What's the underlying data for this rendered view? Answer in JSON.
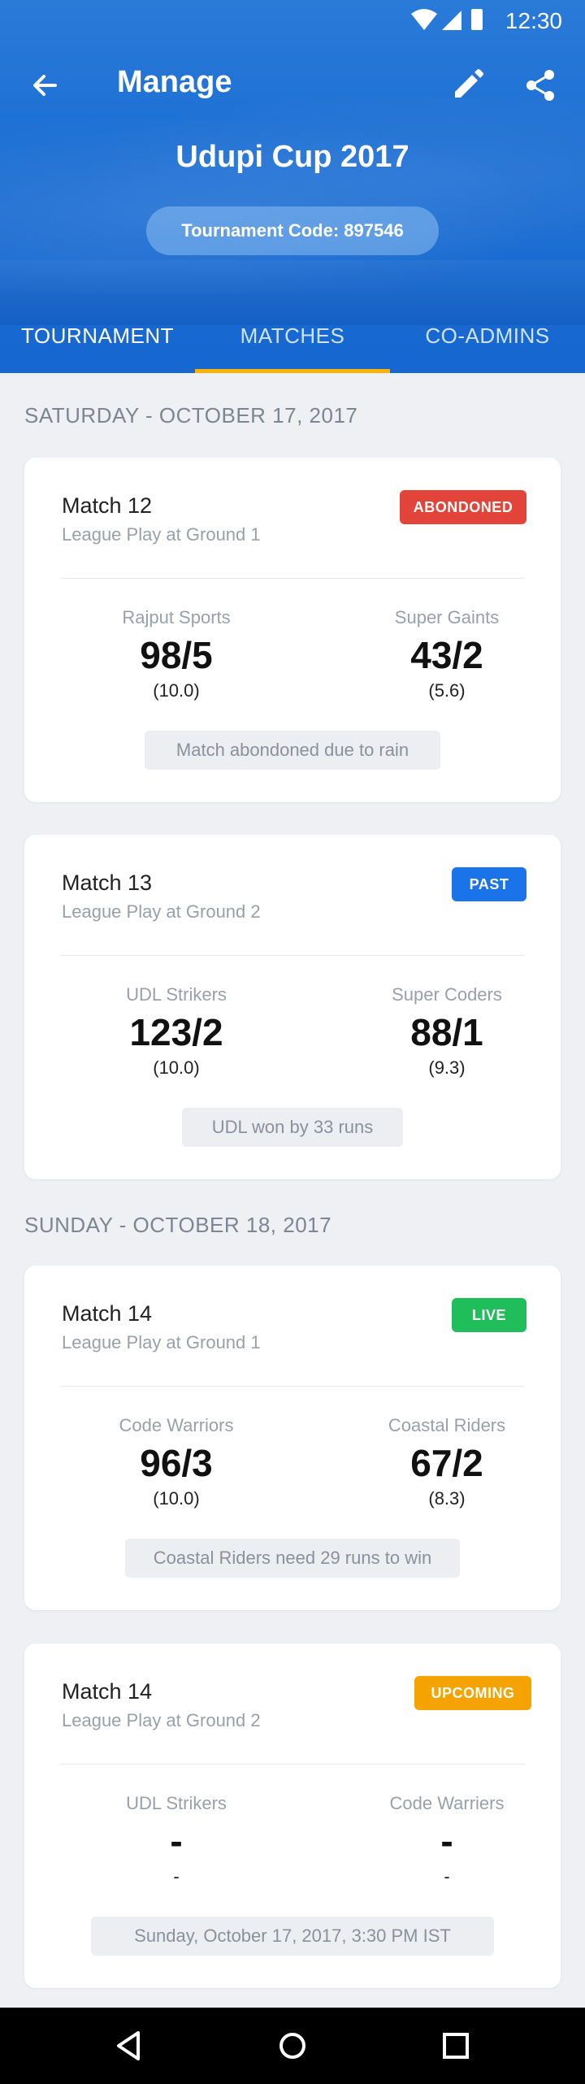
{
  "status": {
    "time": "12:30"
  },
  "header": {
    "title": "Manage",
    "tournament": "Udupi Cup 2017",
    "code": "Tournament Code: 897546"
  },
  "tabs": [
    "TOURNAMENT",
    "MATCHES",
    "CO-ADMINS"
  ],
  "sections": [
    {
      "date": "SATURDAY - OCTOBER 17, 2017"
    },
    {
      "date": "SUNDAY - OCTOBER 18, 2017"
    }
  ],
  "matches": [
    {
      "name": "Match 12",
      "venue": "League Play at Ground 1",
      "badge": "ABONDONED",
      "badge_color": "#e2443a",
      "team1": {
        "name": "Rajput Sports",
        "score": "98/5",
        "overs": "(10.0)"
      },
      "team2": {
        "name": "Super Gaints",
        "score": "43/2",
        "overs": "(5.6)"
      },
      "result": "Match abondoned due to rain"
    },
    {
      "name": "Match 13",
      "venue": "League Play at Ground 2",
      "badge": "PAST",
      "badge_color": "#1a73e8",
      "team1": {
        "name": "UDL Strikers",
        "score": "123/2",
        "overs": "(10.0)"
      },
      "team2": {
        "name": "Super Coders",
        "score": "88/1",
        "overs": "(9.3)"
      },
      "result": "UDL won by 33 runs"
    },
    {
      "name": "Match 14",
      "venue": "League Play at Ground 1",
      "badge": "LIVE",
      "badge_color": "#1fbe5a",
      "team1": {
        "name": "Code Warriors",
        "score": "96/3",
        "overs": "(10.0)"
      },
      "team2": {
        "name": "Coastal Riders",
        "score": "67/2",
        "overs": "(8.3)"
      },
      "result": "Coastal Riders need 29 runs to win"
    },
    {
      "name": "Match 14",
      "venue": "League Play at Ground 2",
      "badge": "UPCOMING",
      "badge_color": "#f5a300",
      "team1": {
        "name": "UDL Strikers",
        "score": "-",
        "overs": "-"
      },
      "team2": {
        "name": "Code Warriers",
        "score": "-",
        "overs": "-"
      },
      "result": "Sunday, October 17, 2017, 3:30 PM IST"
    }
  ]
}
